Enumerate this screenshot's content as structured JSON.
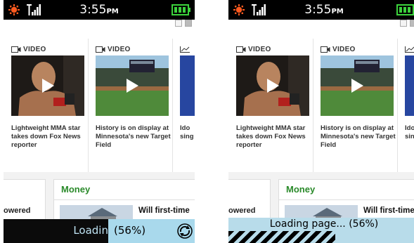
{
  "screens": [
    {
      "status": {
        "time": "3:55",
        "ampm": "PM"
      },
      "cards": [
        {
          "label": "VIDEO",
          "caption": "Lightweight MMA star takes down Fox News reporter"
        },
        {
          "label": "VIDEO",
          "caption": "History is on display at Minnesota's new Target Field"
        },
        {
          "label": "",
          "caption": "Ido sing"
        }
      ],
      "left_text": "owered",
      "money": {
        "title": "Money",
        "headline": "Will first-time"
      },
      "loading": {
        "text_left": "Loadin",
        "text_right": "(56%)",
        "progress": 0.56
      }
    },
    {
      "status": {
        "time": "3:55",
        "ampm": "PM"
      },
      "cards": [
        {
          "label": "VIDEO",
          "caption": "Lightweight MMA star takes down Fox News reporter"
        },
        {
          "label": "VIDEO",
          "caption": "History is on display at Minnesota's new Target Field"
        },
        {
          "label": "",
          "caption": "Ido sing"
        }
      ],
      "left_text": "owered",
      "money": {
        "title": "Money",
        "headline": "Will first-time"
      },
      "loading": {
        "text": "Loading page... (56%)",
        "progress": 0.56
      }
    }
  ],
  "icons": {
    "status_left": "settings-sun-icon",
    "signal": "signal-strength-icon",
    "battery": "battery-icon",
    "video": "video-camera-icon",
    "chart": "chart-icon",
    "play": "play-icon",
    "spinner": "refresh-spinner-icon"
  },
  "colors": {
    "status_bar": "#000000",
    "status_icon": "#ff5a1f",
    "battery": "#3cd23c",
    "money_title": "#2a8a2a",
    "loading_light": "#a9d9ec",
    "loading_dark": "#0b0b0b"
  }
}
